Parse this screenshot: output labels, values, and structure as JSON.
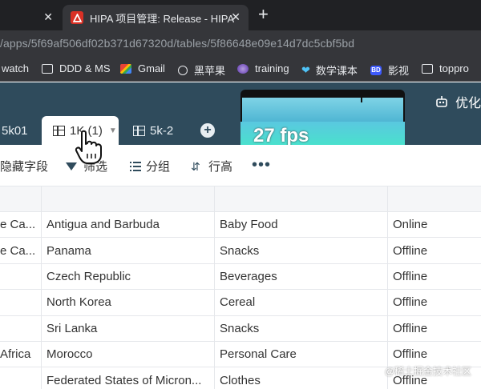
{
  "browser": {
    "left_tab_title": "",
    "active_tab_title": "HIPA 项目管理: Release - HIPA",
    "new_tab_symbol": "+",
    "close_symbol": "✕",
    "url": "/apps/5f69af506df02b371d67320d/tables/5f86648e09e14d7dc5cbf5bd"
  },
  "bookmarks": [
    {
      "label": "watch",
      "icon": "none"
    },
    {
      "label": "DDD & MS",
      "icon": "folder-icon"
    },
    {
      "label": "Gmail",
      "icon": "gmail-icon"
    },
    {
      "label": "黑苹果",
      "icon": "apple-icon"
    },
    {
      "label": "training",
      "icon": "training-icon"
    },
    {
      "label": "数学课本",
      "icon": "heart-icon"
    },
    {
      "label": "影视",
      "icon": "bd-icon"
    },
    {
      "label": "toppro",
      "icon": "folder-icon"
    }
  ],
  "app": {
    "header_right_text": "优化"
  },
  "view_tabs": [
    {
      "label": "5k01",
      "active": false
    },
    {
      "label": "1K (1)",
      "active": true
    },
    {
      "label": "5k-2",
      "active": false
    }
  ],
  "fps": {
    "label": "27 fps",
    "value": 27
  },
  "toolbar": {
    "hide_fields": "隐藏字段",
    "filter": "筛选",
    "group": "分组",
    "row_height": "行高",
    "more": "•••"
  },
  "table": {
    "rows": [
      [
        "e Ca...",
        "Antigua and Barbuda",
        "Baby Food",
        "Online"
      ],
      [
        "e Ca...",
        "Panama",
        "Snacks",
        "Offline"
      ],
      [
        "",
        "Czech Republic",
        "Beverages",
        "Offline"
      ],
      [
        "",
        "North Korea",
        "Cereal",
        "Offline"
      ],
      [
        "",
        "Sri Lanka",
        "Snacks",
        "Offline"
      ],
      [
        "Africa",
        "Morocco",
        "Personal Care",
        "Offline"
      ],
      [
        "",
        "Federated States of Micron...",
        "Clothes",
        "Offline"
      ]
    ]
  },
  "watermark": "@稀土掘金技术社区",
  "colors": {
    "chrome_dark": "#202124",
    "chrome_mid": "#35363a",
    "app_header": "#2f4b5c",
    "grid_line": "#e5e7eb"
  }
}
